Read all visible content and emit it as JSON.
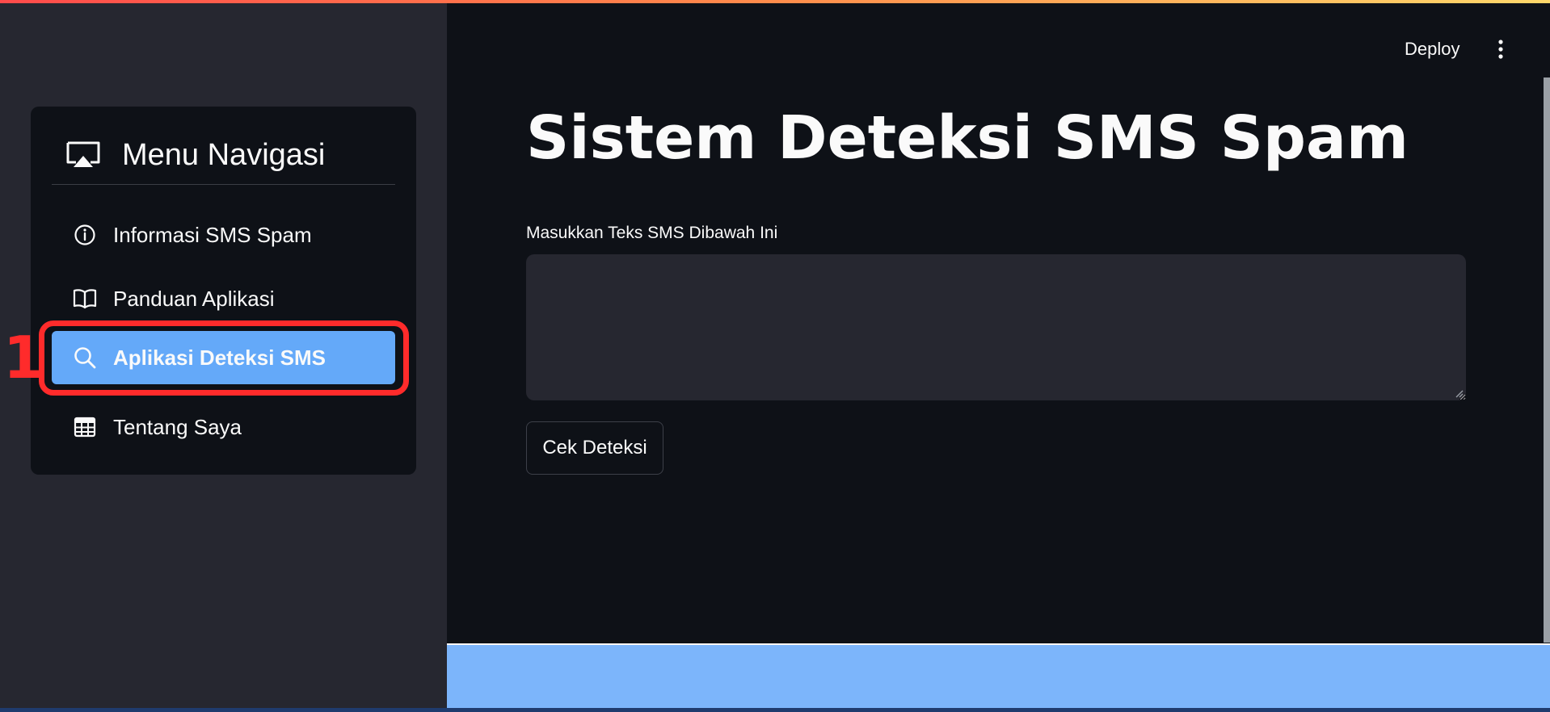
{
  "app": {
    "title": "Sistem Deteksi SMS Spam",
    "accent_color": "#ff4b4b",
    "active_nav_color": "#64a9f9"
  },
  "header": {
    "deploy_label": "Deploy",
    "menu_icon": "kebab-menu-icon"
  },
  "sidebar": {
    "title": "Menu Navigasi",
    "title_icon": "cast-icon",
    "items": [
      {
        "label": "Informasi SMS Spam",
        "icon": "info-icon",
        "active": false
      },
      {
        "label": "Panduan Aplikasi",
        "icon": "book-icon",
        "active": false
      },
      {
        "label": "Aplikasi Deteksi SMS",
        "icon": "search-icon",
        "active": true
      },
      {
        "label": "Tentang Saya",
        "icon": "table-icon",
        "active": false
      }
    ]
  },
  "annotation": {
    "number": "1",
    "color": "#ff2b2b"
  },
  "main": {
    "input_label": "Masukkan Teks SMS Dibawah Ini",
    "input_value": "",
    "submit_label": "Cek Deteksi"
  }
}
